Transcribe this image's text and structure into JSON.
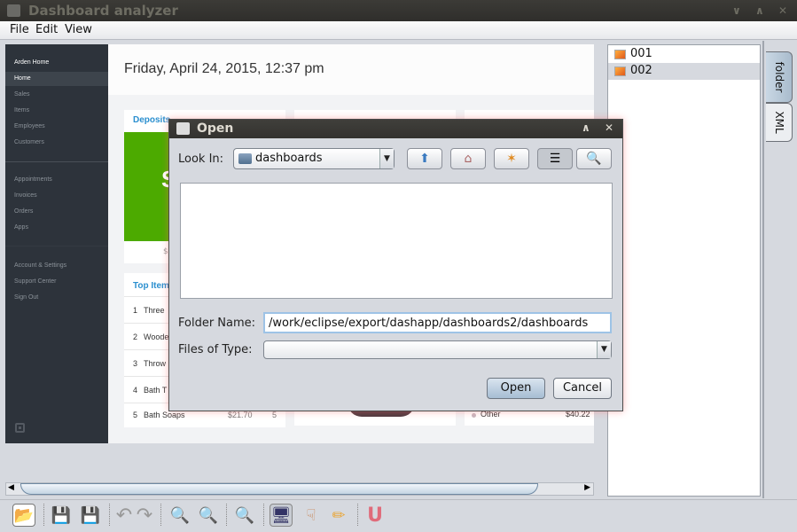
{
  "window": {
    "title": "Dashboard analyzer",
    "controls": [
      "minimize",
      "maximize",
      "close"
    ]
  },
  "menu": {
    "items": [
      "File",
      "Edit",
      "View"
    ]
  },
  "dashboard": {
    "sidebar": {
      "brand": "Arden Home",
      "group1": [
        "Home",
        "Sales",
        "Items",
        "Employees",
        "Customers"
      ],
      "group2": [
        "Appointments",
        "Invoices",
        "Orders",
        "Apps"
      ],
      "group3": [
        "Account & Settings",
        "Support Center",
        "Sign Out"
      ],
      "active": "Home"
    },
    "date": "Friday, April 24, 2015, 12:37 pm",
    "deposits": {
      "title": "Deposits",
      "big_fragment": "S",
      "footer_fragment": "$"
    },
    "top_items": {
      "title": "Top Items",
      "rows": [
        {
          "rank": "1",
          "name": "Three",
          "price": "",
          "qty": ""
        },
        {
          "rank": "2",
          "name": "Woode",
          "price": "",
          "qty": ""
        },
        {
          "rank": "3",
          "name": "Throw",
          "price": "",
          "qty": ""
        },
        {
          "rank": "4",
          "name": "Bath T",
          "price": "",
          "qty": ""
        },
        {
          "rank": "5",
          "name": "Bath Soaps",
          "price": "$21.70",
          "qty": "5"
        }
      ]
    },
    "legend_other": {
      "label": "Other",
      "value": "$40.22"
    }
  },
  "file_list": {
    "items": [
      "001",
      "002"
    ],
    "selected": "002"
  },
  "side_tabs": [
    "folder",
    "XML"
  ],
  "active_side_tab": "folder",
  "dialog": {
    "title": "Open",
    "look_in_label": "Look In:",
    "look_in_value": "dashboards",
    "toolbar_buttons": [
      "up-one-level",
      "home",
      "new-folder",
      "list-view",
      "details-view"
    ],
    "folder_name_label": "Folder Name:",
    "folder_name_value": "/work/eclipse/export/dashapp/dashboards2/dashboards",
    "files_of_type_label": "Files of Type:",
    "files_of_type_value": "",
    "open_label": "Open",
    "cancel_label": "Cancel"
  },
  "toolbar": {
    "buttons": [
      "open-folder",
      "save",
      "save-as",
      "undo",
      "redo",
      "zoom-in",
      "zoom-out",
      "zoom",
      "presentation",
      "hand",
      "pencil",
      "magnet"
    ]
  }
}
